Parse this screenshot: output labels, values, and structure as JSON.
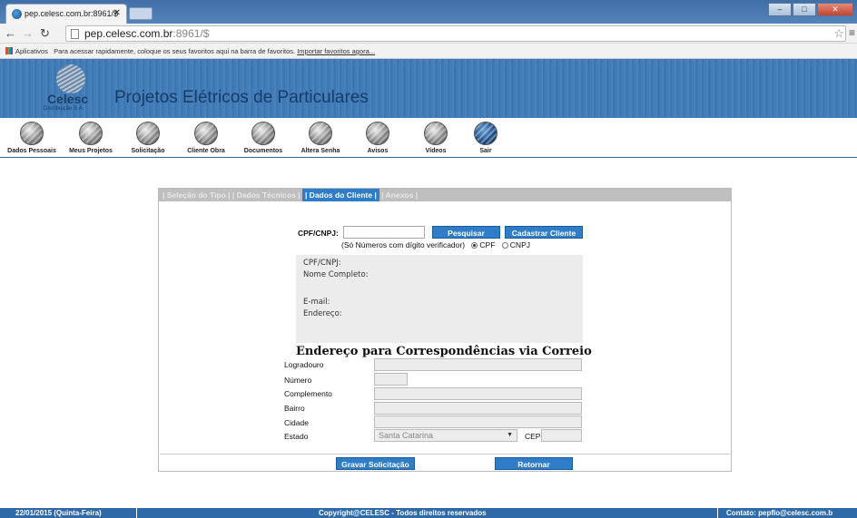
{
  "browser": {
    "tab_title": "pep.celesc.com.br:8961/$",
    "url_host": "pep.celesc.com.br",
    "url_path": ":8961/$",
    "bookmarks_apps_label": "Aplicativos",
    "bookmarks_text": "Para acessar rapidamente, coloque os seus favoritos aqui na barra de favoritos.",
    "bookmarks_link": "Importar favoritos agora..."
  },
  "header": {
    "logo_name": "Celesc",
    "logo_sub": "Distribuição S.A.",
    "site_title": "Projetos Elétricos de Particulares"
  },
  "menu": {
    "items": [
      {
        "label": "Dados Pessoais"
      },
      {
        "label": "Meus Projetos"
      },
      {
        "label": "Solicitação"
      },
      {
        "label": "Cliente Obra"
      },
      {
        "label": "Documentos"
      },
      {
        "label": "Altera Senha"
      },
      {
        "label": "Avisos"
      },
      {
        "label": "Vídeos"
      },
      {
        "label": "Sair"
      }
    ]
  },
  "wizard_tabs": {
    "tab1": "| Seleção do Tipo |",
    "tab2": "| Dados Técnicos |",
    "tab3": "| Dados do Cliente |",
    "tab4": "| Anexos |"
  },
  "client": {
    "cpf_label": "CPF/CNPJ:",
    "search_button": "Pesquisar",
    "register_button": "Cadastrar Cliente",
    "hint": "(Só Números com dígito verificador)",
    "radio_cpf": "CPF",
    "radio_cnpj": "CNPJ",
    "info_cpf": "CPF/CNPJ:",
    "info_name": "Nome Completo:",
    "info_email": "E-mail:",
    "info_address": "Endereço:"
  },
  "address": {
    "title": "Endereço para Correspondências via Correio",
    "logradouro": "Logradouro",
    "numero": "Número",
    "complemento": "Complemento",
    "bairro": "Bairro",
    "cidade": "Cidade",
    "estado": "Estado",
    "estado_value": "Santa Catarina",
    "cep": "CEP"
  },
  "actions": {
    "save": "Gravar Solicitação",
    "back": "Retornar"
  },
  "footer": {
    "date": "22/01/2015 (Quinta-Feira)",
    "copyright": "Copyright@CELESC - Todos direitos reservados",
    "contact": "Contato: pepflo@celesc.com.b"
  }
}
